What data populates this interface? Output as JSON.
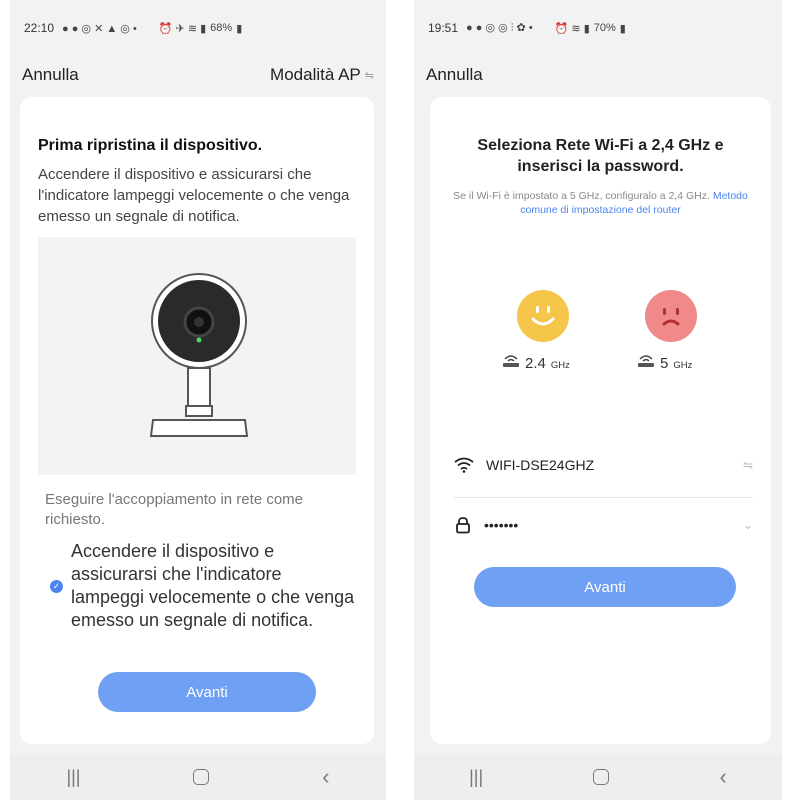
{
  "left": {
    "status": {
      "time": "22:10",
      "battery": "68%"
    },
    "topbar": {
      "cancel": "Annulla",
      "mode": "Modalità AP",
      "swap_icon": "⇋"
    },
    "title": "Prima ripristina il dispositivo.",
    "description": "Accendere il dispositivo e assicurarsi che l'indicatore lampeggi velocemente o che venga emesso un segnale di notifica.",
    "note": "Eseguire l'accoppiamento in rete come richiesto.",
    "checkbox_label": "Accendere il dispositivo e assicurarsi che l'indicatore lampeggi velocemente o che venga emesso un segnale di notifica.",
    "checkbox_checked": true,
    "next_button": "Avanti"
  },
  "right": {
    "status": {
      "time": "19:51",
      "battery": "70%"
    },
    "topbar": {
      "cancel": "Annulla"
    },
    "title": "Seleziona Rete Wi-Fi a 2,4 GHz e inserisci la password.",
    "hint": "Se il Wi-Fi è impostato a 5 GHz, configuralo a 2,4 GHz.",
    "hint_link": "Metodo comune di impostazione del router",
    "band_good": {
      "value": "2.4",
      "unit": "GHz"
    },
    "band_bad": {
      "value": "5",
      "unit": "GHz"
    },
    "ssid": "WIFI-DSE24GHZ",
    "password_mask": "•••••••",
    "next_button": "Avanti"
  },
  "navbar": {
    "recents": "|||",
    "back": "‹"
  },
  "colors": {
    "accent": "#6fa0f3",
    "check": "#4a84f0",
    "good_face": "#f6c64b",
    "bad_face": "#f08a8a"
  },
  "icons": [
    "wifi-icon",
    "lock-icon",
    "router-icon",
    "swap-icon",
    "chevron-down-icon",
    "check-icon",
    "camera-icon",
    "smiley-icon",
    "sad-face-icon"
  ]
}
